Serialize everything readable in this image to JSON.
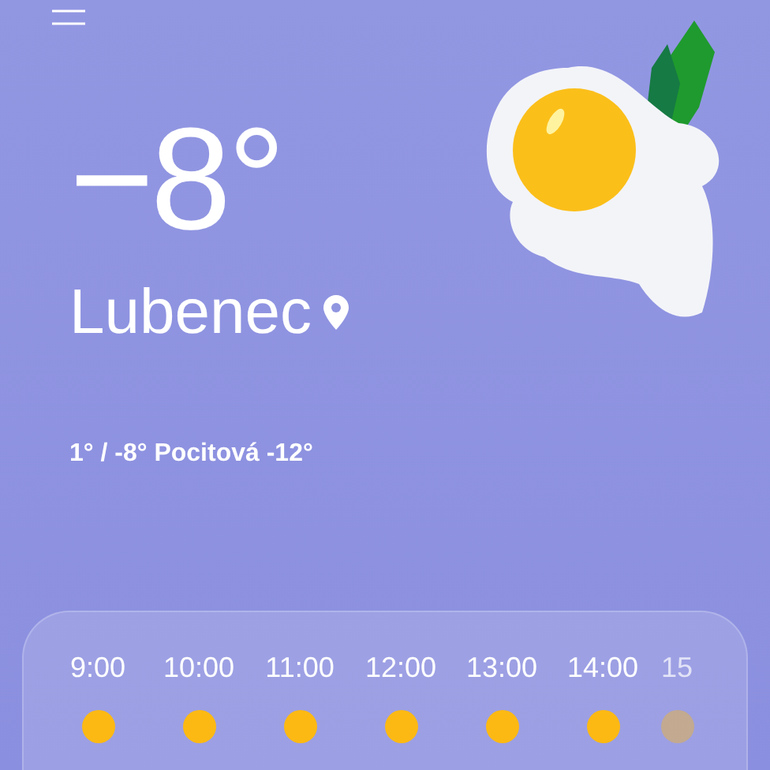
{
  "temperature": "−8°",
  "location": "Lubenec",
  "summary": "1° / -8° Pocitová -12°",
  "hours": [
    {
      "time": "9:00"
    },
    {
      "time": "10:00"
    },
    {
      "time": "11:00"
    },
    {
      "time": "12:00"
    },
    {
      "time": "13:00"
    },
    {
      "time": "14:00"
    },
    {
      "time": "15"
    }
  ]
}
